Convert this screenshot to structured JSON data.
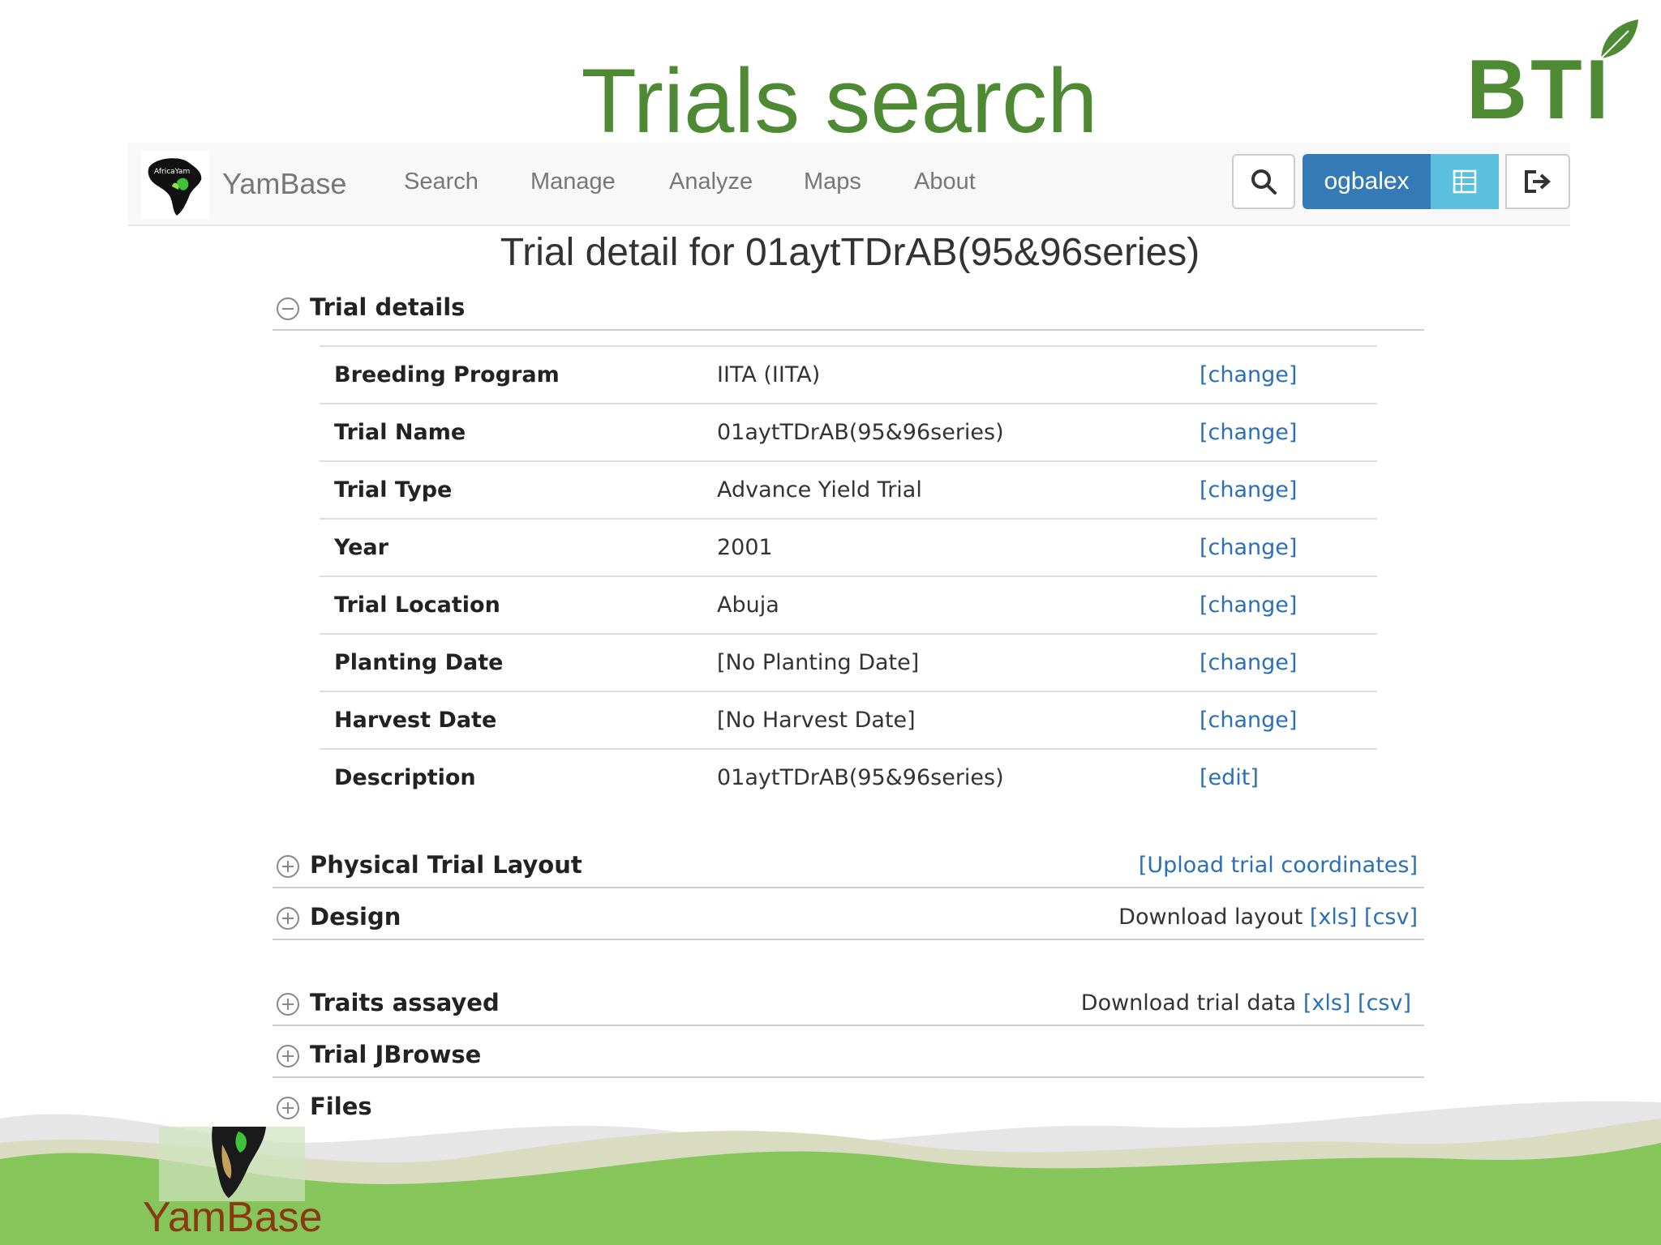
{
  "slide": {
    "title": "Trials search",
    "logo_text": "BTI",
    "footer_label": "YamBase",
    "accent_color": "#4e8a34"
  },
  "navbar": {
    "brand": "YamBase",
    "logo_caption": "AfricaYam",
    "items": [
      "Search",
      "Manage",
      "Analyze",
      "Maps",
      "About"
    ],
    "username": "ogbalex",
    "search_icon": "search-icon",
    "grid_icon": "grid-icon",
    "logout_icon": "logout-icon"
  },
  "page": {
    "title": "Trial detail for 01aytTDrAB(95&96series)"
  },
  "sections": {
    "trial_details": {
      "label": "Trial details",
      "expanded": true
    },
    "physical_layout": {
      "label": "Physical Trial Layout",
      "link": "[Upload trial coordinates]"
    },
    "design": {
      "label": "Design",
      "prefix": "Download layout",
      "xls": "[xls]",
      "csv": "[csv]"
    },
    "traits": {
      "label": "Traits assayed",
      "prefix": "Download trial data",
      "xls": "[xls]",
      "csv": "[csv]"
    },
    "jbrowse": {
      "label": "Trial JBrowse"
    },
    "files": {
      "label": "Files"
    }
  },
  "details": [
    {
      "label": "Breeding Program",
      "value": "IITA (IITA)",
      "action": "[change]"
    },
    {
      "label": "Trial Name",
      "value": "01aytTDrAB(95&96series)",
      "action": "[change]"
    },
    {
      "label": "Trial Type",
      "value": "Advance Yield Trial",
      "action": "[change]"
    },
    {
      "label": "Year",
      "value": "2001",
      "action": "[change]"
    },
    {
      "label": "Trial Location",
      "value": "Abuja",
      "action": "[change]"
    },
    {
      "label": "Planting Date",
      "value": "[No Planting Date]",
      "action": "[change]"
    },
    {
      "label": "Harvest Date",
      "value": "[No Harvest Date]",
      "action": "[change]"
    },
    {
      "label": "Description",
      "value": "01aytTDrAB(95&96series)",
      "action": "[edit]"
    }
  ]
}
